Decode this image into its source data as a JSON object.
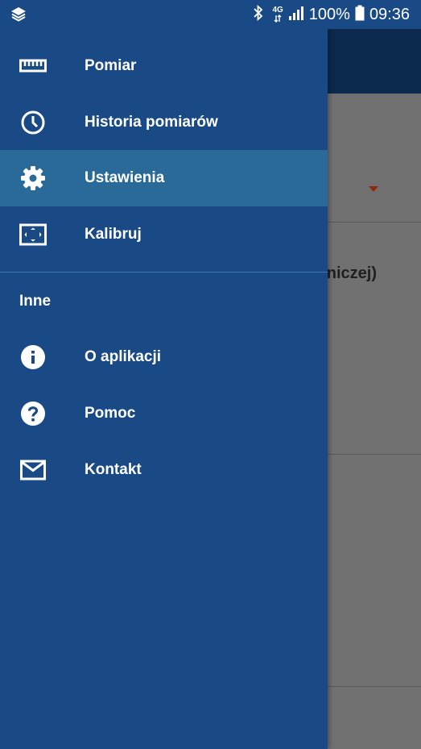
{
  "status_bar": {
    "battery": "100%",
    "time": "09:36",
    "network_top": "4G",
    "icons": [
      "layers-icon",
      "bluetooth-icon",
      "network-icon",
      "signal-icon",
      "battery-icon"
    ]
  },
  "background": {
    "partial_text": "rniczej)"
  },
  "drawer": {
    "items": [
      {
        "label": "Pomiar",
        "icon": "ruler-icon"
      },
      {
        "label": "Historia pomiarów",
        "icon": "clock-icon"
      },
      {
        "label": "Ustawienia",
        "icon": "gear-icon",
        "active": true
      },
      {
        "label": "Kalibruj",
        "icon": "calibrate-icon"
      }
    ],
    "section_title": "Inne",
    "other_items": [
      {
        "label": "O aplikacji",
        "icon": "info-icon"
      },
      {
        "label": "Pomoc",
        "icon": "help-icon"
      },
      {
        "label": "Kontakt",
        "icon": "mail-icon"
      }
    ]
  },
  "colors": {
    "drawer_bg": "#1a4a85",
    "active_bg": "#2a6a98",
    "divider": "#3d78b8",
    "appbar": "#0c2a4d",
    "scrim": "#717171",
    "dropdown_arrow": "#8b2b12"
  }
}
